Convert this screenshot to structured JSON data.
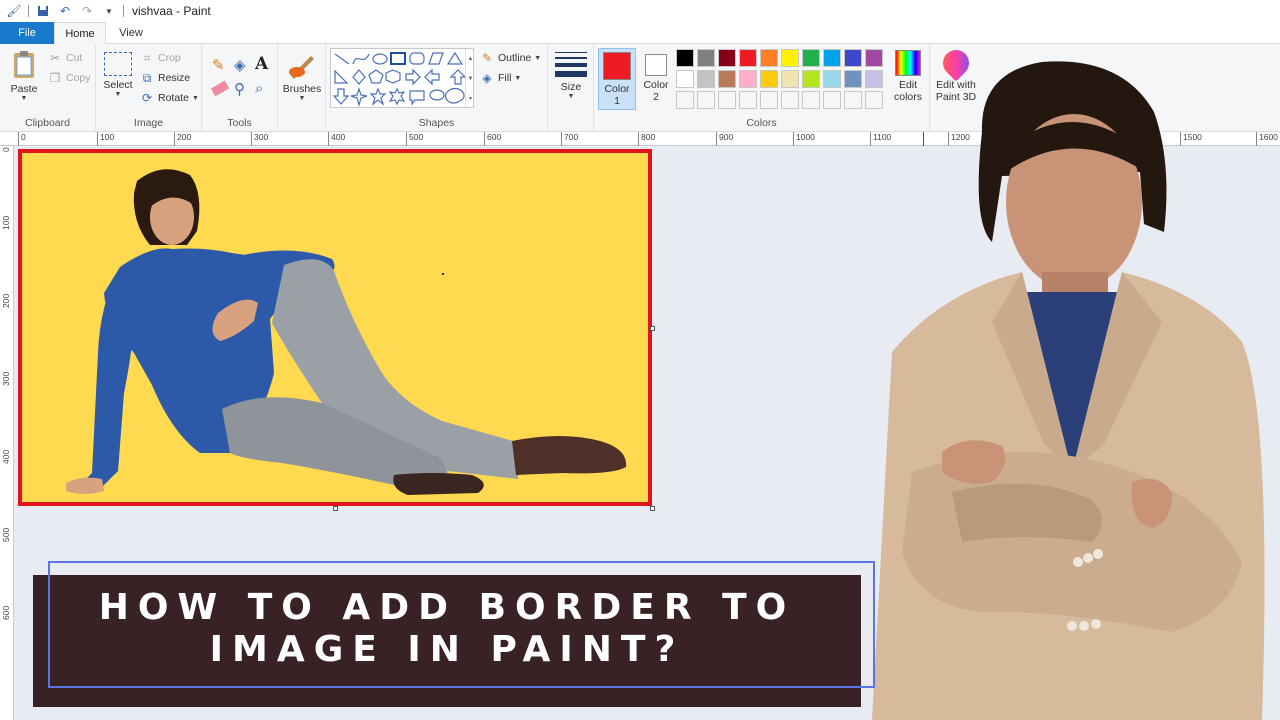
{
  "window": {
    "title": "vishvaa - Paint"
  },
  "tabs": [
    {
      "label": "File"
    },
    {
      "label": "Home"
    },
    {
      "label": "View"
    }
  ],
  "ribbon": {
    "clipboard": {
      "label": "Clipboard",
      "paste": "Paste",
      "cut": "Cut",
      "copy": "Copy"
    },
    "image": {
      "label": "Image",
      "select": "Select",
      "crop": "Crop",
      "resize": "Resize",
      "rotate": "Rotate"
    },
    "tools": {
      "label": "Tools"
    },
    "brushes": {
      "label": "Brushes"
    },
    "shapes": {
      "label": "Shapes",
      "outline": "Outline",
      "fill": "Fill"
    },
    "size": {
      "label": "Size"
    },
    "color1": {
      "label": "Color",
      "num": "1",
      "value": "#ed1c24"
    },
    "color2": {
      "label": "Color",
      "num": "2",
      "value": "#ffffff"
    },
    "colors": {
      "label": "Colors",
      "edit": "Edit",
      "edit2": "colors"
    },
    "paint3d": {
      "label": "Edit with",
      "label2": "Paint 3D"
    }
  },
  "palette_row1": [
    "#000000",
    "#7f7f7f",
    "#880015",
    "#ed1c24",
    "#ff7f27",
    "#fff200",
    "#22b14c",
    "#00a2e8",
    "#3f48cc",
    "#a349a4"
  ],
  "palette_row2": [
    "#ffffff",
    "#c3c3c3",
    "#b97a57",
    "#ffaec9",
    "#ffc90e",
    "#efe4b0",
    "#b5e61d",
    "#99d9ea",
    "#7092be",
    "#c8bfe7"
  ],
  "ruler_h": [
    "0",
    "100",
    "200",
    "300",
    "400",
    "500",
    "600",
    "700",
    "800",
    "900",
    "1000",
    "1100",
    "1200",
    "1500",
    "1600"
  ],
  "ruler_v": [
    "0",
    "100",
    "200",
    "300",
    "400",
    "500",
    "600"
  ],
  "canvas": {
    "background": "#ffd94f",
    "border_color": "#e0141b"
  },
  "banner": {
    "line1": "HOW TO ADD BORDER TO",
    "line2": "IMAGE IN PAINT?"
  }
}
